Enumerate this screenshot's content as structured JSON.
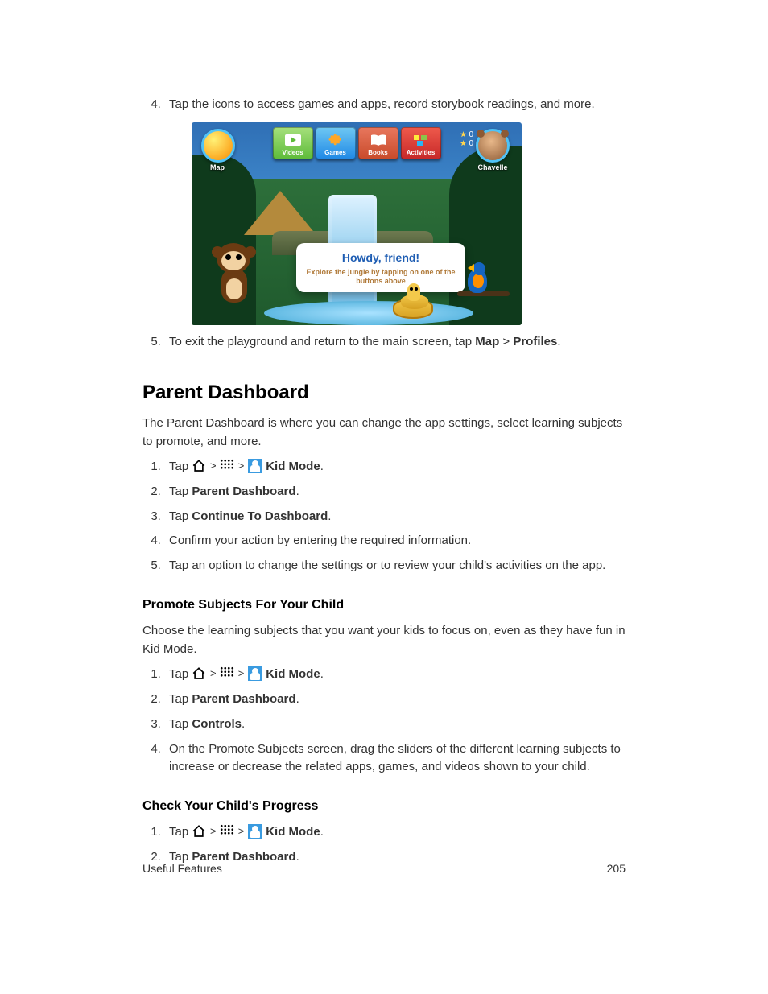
{
  "intro_list": {
    "start": 4,
    "items": [
      {
        "pre": "Tap the icons to access games and apps, record storybook readings, and more."
      },
      {
        "pre": "To exit the playground and return to the main screen, tap ",
        "b1": "Map",
        "mid": " > ",
        "b2": "Profiles",
        "post": "."
      }
    ]
  },
  "screenshot": {
    "map_label": "Map",
    "tabs": {
      "videos": "Videos",
      "games": "Games",
      "books": "Books",
      "activities": "Activities"
    },
    "stars": [
      "0",
      "0"
    ],
    "avatar_name": "Chavelle",
    "bubble_title": "Howdy, friend!",
    "bubble_text": "Explore the jungle by tapping on one of the buttons above"
  },
  "parent_dashboard": {
    "heading": "Parent Dashboard",
    "intro": "The Parent Dashboard is where you can change the app settings, select learning subjects to promote, and more.",
    "steps": [
      {
        "tapline": true,
        "kidmode": "Kid Mode",
        "after": "."
      },
      {
        "pre": "Tap ",
        "b1": "Parent Dashboard",
        "post": "."
      },
      {
        "pre": "Tap ",
        "b1": "Continue To Dashboard",
        "post": "."
      },
      {
        "pre": "Confirm your action by entering the required information."
      },
      {
        "pre": "Tap an option to change the settings or to review your child's activities on the app."
      }
    ]
  },
  "promote_subjects": {
    "heading": "Promote Subjects For Your Child",
    "intro": "Choose the learning subjects that you want your kids to focus on, even as they have fun in Kid Mode.",
    "steps": [
      {
        "tapline": true,
        "kidmode": "Kid Mode",
        "after": "."
      },
      {
        "pre": "Tap ",
        "b1": "Parent Dashboard",
        "post": "."
      },
      {
        "pre": "Tap ",
        "b1": "Controls",
        "post": "."
      },
      {
        "pre": "On the Promote Subjects screen, drag the sliders of the different learning subjects to increase or decrease the related apps, games, and videos shown to your child."
      }
    ]
  },
  "check_progress": {
    "heading": "Check Your Child's Progress",
    "steps": [
      {
        "tapline": true,
        "kidmode": "Kid Mode",
        "after": "."
      },
      {
        "pre": "Tap ",
        "b1": "Parent Dashboard",
        "post": "."
      }
    ]
  },
  "footer": {
    "section": "Useful Features",
    "page": "205"
  },
  "labels": {
    "tap": "Tap "
  }
}
